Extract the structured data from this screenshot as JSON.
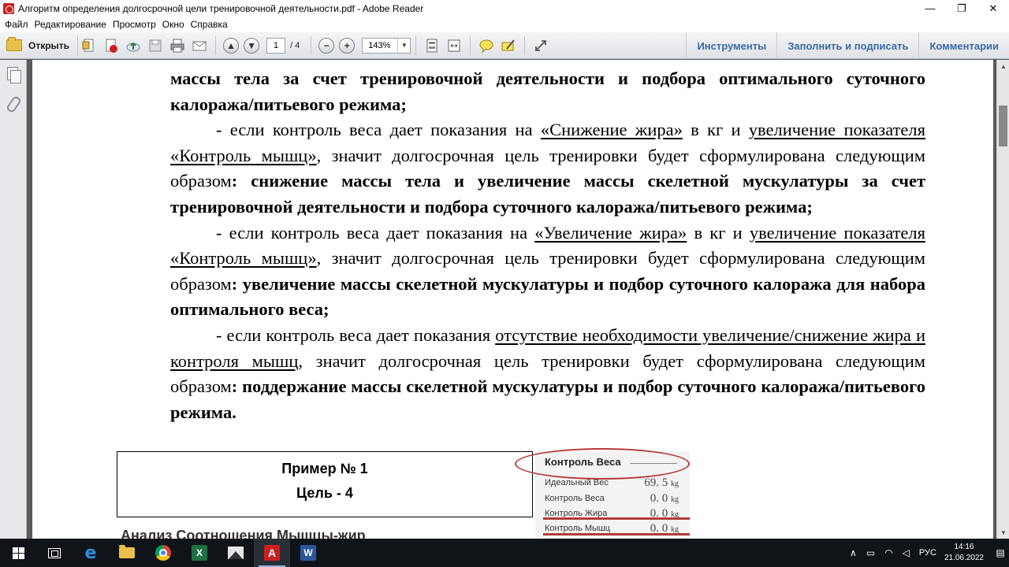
{
  "window": {
    "title": "Алгоритм определения долгосрочной цели тренировочной деятельности.pdf - Adobe Reader",
    "minimize": "—",
    "restore": "❐",
    "close": "✕"
  },
  "menu": {
    "items": [
      "Файл",
      "Редактирование",
      "Просмотр",
      "Окно",
      "Справка"
    ]
  },
  "toolbar": {
    "open_label": "Открыть",
    "page_current": "1",
    "page_total": "/ 4",
    "zoom": "143%",
    "tools_label": "Инструменты",
    "fill_sign_label": "Заполнить и подписать",
    "comments_label": "Комментарии"
  },
  "document": {
    "p1_bold": "массы тела за счет тренировочной деятельности и подбора оптимального суточного калоража/питьевого режима;",
    "p2": {
      "dash": "-   если контроль веса дает показания на ",
      "u1": "«Снижение жира»",
      "mid": " в кг и ",
      "u2": "увеличение показателя «Контроль мышц»",
      "rest": ", значит долгосрочная цель тренировки будет сформулирована следующим образом",
      "bold": ": снижение массы тела и увеличение массы скелетной мускулатуры за счет тренировочной деятельности и подбора суточного калоража/питьевого режима;"
    },
    "p3": {
      "dash": "-   если контроль веса дает показания на ",
      "u1": "«Увеличение жира»",
      "mid": " в кг и ",
      "u2": "увеличение показателя «Контроль мышц»",
      "rest": ", значит долгосрочная цель тренировки будет сформулирована следующим образом",
      "bold": ": увеличение массы скелетной мускулатуры и подбор суточного калоража для набора оптимального веса;"
    },
    "p4": {
      "dash": "-        если контроль веса дает показания ",
      "u1": "отсутствие необходимости увеличение/снижение  жира и контроля мышц",
      "rest": ", значит долгосрочная цель тренировки будет сформулирована следующим образом",
      "bold": ": поддержание массы скелетной мускулатуры и подбор суточного калоража/питьевого режима."
    },
    "example_title": "Пример № 1",
    "example_goal": "Цель - 4",
    "analysis_title": "Анализ Соотношения Мышцы-жир",
    "scale": {
      "header": "Контроль Веса",
      "rows": [
        {
          "label": "Идеальный Вес",
          "value": "69. 5",
          "unit": "kg"
        },
        {
          "label": "Контроль Веса",
          "value": "0. 0",
          "unit": "kg"
        },
        {
          "label": "Контроль Жира",
          "value": "0. 0",
          "unit": "kg"
        },
        {
          "label": "Контроль Мышц",
          "value": "0. 0",
          "unit": "kg"
        }
      ]
    }
  },
  "taskbar": {
    "excel_letter": "X",
    "acrobat_letter": "A",
    "word_letter": "W",
    "edge_letter": "e",
    "language": "РУС",
    "time": "14:16",
    "date": "21.06.2022"
  }
}
